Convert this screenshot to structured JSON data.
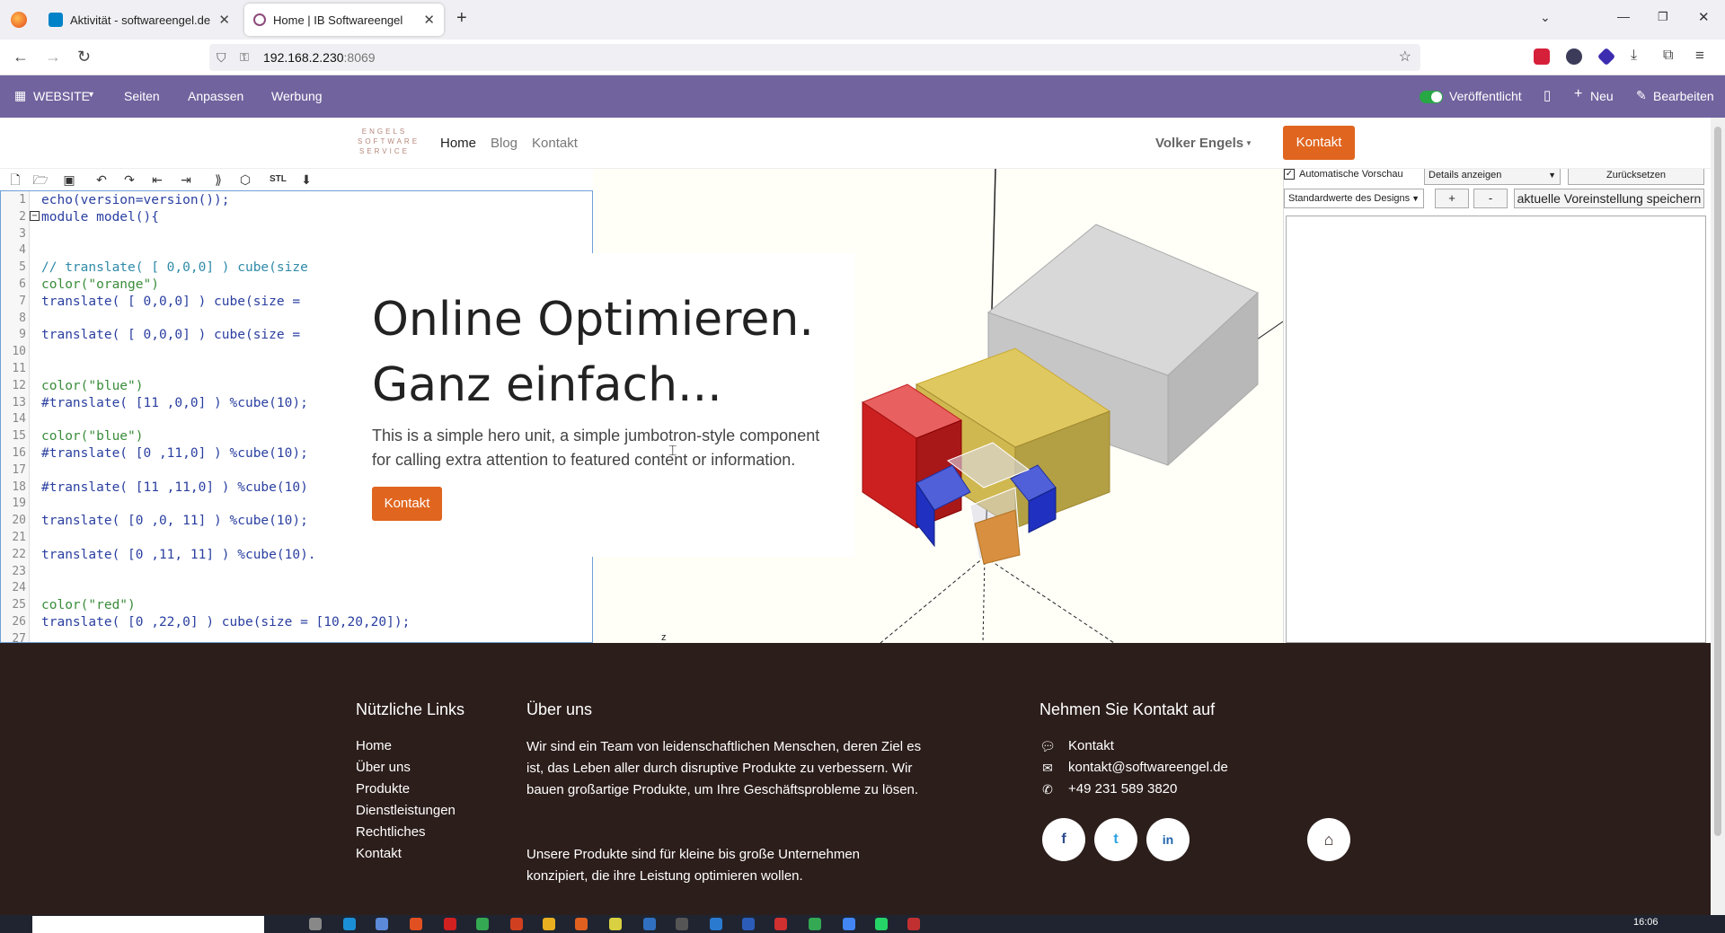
{
  "browser": {
    "tabs": [
      {
        "label": "Aktivität - softwareengel.de",
        "active": false
      },
      {
        "label": "Home | IB Softwareengel",
        "active": true
      }
    ],
    "new_tab": "+",
    "url_host": "192.168.2.230",
    "url_port": ":8069"
  },
  "adminbar": {
    "website": "WEBSITE",
    "pages": "Seiten",
    "customize": "Anpassen",
    "promote": "Werbung",
    "published": "Veröffentlicht",
    "new": "Neu",
    "edit": "Bearbeiten"
  },
  "header": {
    "logo_lines": [
      "ENGELS",
      "SOFTWARE",
      "SERVICE"
    ],
    "menu": [
      {
        "label": "Home",
        "active": true
      },
      {
        "label": "Blog",
        "active": false
      },
      {
        "label": "Kontakt",
        "active": false
      }
    ],
    "user": "Volker Engels",
    "cta": "Kontakt"
  },
  "editor": {
    "lines": [
      {
        "n": "1",
        "text": "echo(version=version());"
      },
      {
        "n": "2",
        "text": "module model(){"
      },
      {
        "n": "3",
        "text": ""
      },
      {
        "n": "4",
        "text": ""
      },
      {
        "n": "5",
        "text": "// translate( [ 0,0,0] ) cube(size"
      },
      {
        "n": "6",
        "text": "color(\"orange\")"
      },
      {
        "n": "7",
        "text": "translate( [ 0,0,0] ) cube(size ="
      },
      {
        "n": "8",
        "text": ""
      },
      {
        "n": "9",
        "text": "translate( [ 0,0,0] ) cube(size ="
      },
      {
        "n": "10",
        "text": ""
      },
      {
        "n": "11",
        "text": ""
      },
      {
        "n": "12",
        "text": "color(\"blue\")"
      },
      {
        "n": "13",
        "text": "#translate( [11 ,0,0] ) %cube(10);"
      },
      {
        "n": "14",
        "text": ""
      },
      {
        "n": "15",
        "text": "color(\"blue\")"
      },
      {
        "n": "16",
        "text": "#translate( [0 ,11,0] ) %cube(10);"
      },
      {
        "n": "17",
        "text": ""
      },
      {
        "n": "18",
        "text": "#translate( [11 ,11,0] ) %cube(10)"
      },
      {
        "n": "19",
        "text": ""
      },
      {
        "n": "20",
        "text": "translate( [0 ,0, 11] ) %cube(10);"
      },
      {
        "n": "21",
        "text": ""
      },
      {
        "n": "22",
        "text": "translate( [0 ,11, 11] ) %cube(10)."
      },
      {
        "n": "23",
        "text": ""
      },
      {
        "n": "24",
        "text": ""
      },
      {
        "n": "25",
        "text": "color(\"red\")"
      },
      {
        "n": "26",
        "text": "translate( [0 ,22,0] ) cube(size = [10,20,20]);"
      },
      {
        "n": "27",
        "text": ""
      }
    ]
  },
  "viewer": {
    "axis_label": "z"
  },
  "panel": {
    "auto_preview": "Automatische Vorschau",
    "details": "Details anzeigen",
    "reset": "Zurücksetzen",
    "preset": "Standardwerte des Designs",
    "plus": "+",
    "minus": "-",
    "save_preset": "aktuelle Voreinstellung speichern"
  },
  "hero": {
    "title": "Online Optimieren. Ganz einfach...",
    "text": "This is a simple hero unit, a simple jumbotron-style component for calling extra attention to featured content or information.",
    "button": "Kontakt"
  },
  "footer": {
    "links_title": "Nützliche Links",
    "links": [
      "Home",
      "Über uns",
      "Produkte",
      "Dienstleistungen",
      "Rechtliches",
      "Kontakt"
    ],
    "about_title": "Über uns",
    "about_p1": "Wir sind ein Team von leidenschaftlichen Menschen, deren Ziel es ist, das Leben aller durch disruptive Produkte zu verbessern. Wir bauen großartige Produkte, um Ihre Geschäftsprobleme zu lösen.",
    "about_p2": "Unsere Produkte sind für kleine bis große Unternehmen konzipiert, die ihre Leistung optimieren wollen.",
    "contact_title": "Nehmen Sie Kontakt auf",
    "contact_name": "Kontakt",
    "contact_email": "kontakt@softwareengel.de",
    "contact_phone": "+49 231 589 3820",
    "social": [
      "f",
      "t",
      "in"
    ]
  },
  "taskbar": {
    "time": "16:06"
  },
  "colors": {
    "adminbar": "#71639e",
    "accent": "#e0651f",
    "footer": "#2c1e1b"
  }
}
